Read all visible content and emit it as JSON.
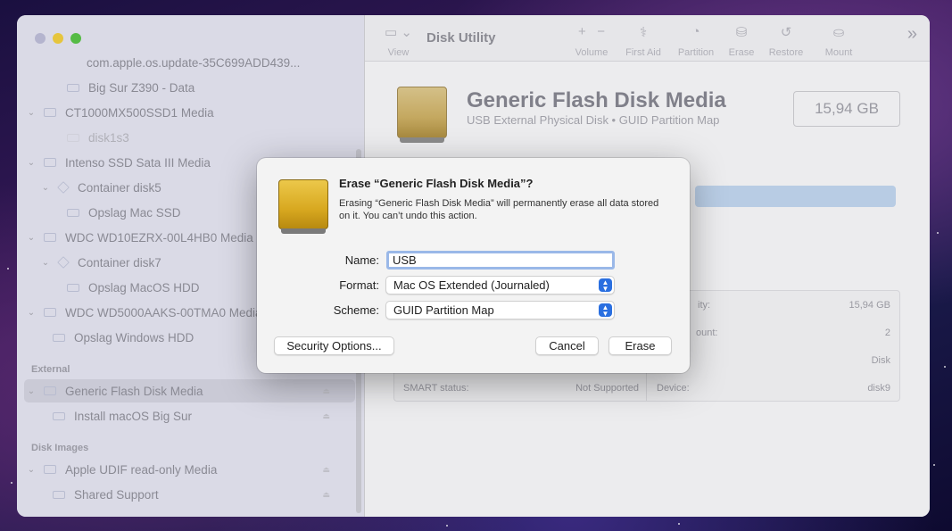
{
  "window": {
    "app_title": "Disk Utility"
  },
  "sidebar": {
    "rows": [
      {
        "label": "com.apple.os.update-35C699ADD439..."
      },
      {
        "label": "Big Sur Z390 - Data"
      },
      {
        "label": "CT1000MX500SSD1 Media"
      },
      {
        "label": "disk1s3"
      },
      {
        "label": "Intenso SSD Sata III Media"
      },
      {
        "label": "Container disk5"
      },
      {
        "label": "Opslag Mac SSD"
      },
      {
        "label": "WDC WD10EZRX-00L4HB0 Media"
      },
      {
        "label": "Container disk7"
      },
      {
        "label": "Opslag MacOS HDD"
      },
      {
        "label": "WDC WD5000AAKS-00TMA0 Media"
      },
      {
        "label": "Opslag Windows HDD"
      },
      {
        "label": "Generic Flash Disk Media"
      },
      {
        "label": "Install macOS Big Sur"
      },
      {
        "label": "Apple UDIF read-only Media"
      },
      {
        "label": "Shared Support"
      }
    ],
    "sections": {
      "external": "External",
      "disk_images": "Disk Images"
    }
  },
  "toolbar": {
    "view": "View",
    "volume": "Volume",
    "first_aid": "First Aid",
    "partition": "Partition",
    "erase": "Erase",
    "restore": "Restore",
    "mount": "Mount",
    "volume_add": "+",
    "volume_remove": "−"
  },
  "disk": {
    "name": "Generic Flash Disk Media",
    "subtitle": "USB External Physical Disk • GUID Partition Map",
    "size": "15,94 GB"
  },
  "info": {
    "capacity_label": "ity:",
    "capacity_value": "15,94 GB",
    "child_count_label": "ount:",
    "child_count_value": "2",
    "type_value": "Disk",
    "smart_label": "SMART status:",
    "smart_value": "Not Supported",
    "device_label": "Device:",
    "device_value": "disk9"
  },
  "dialog": {
    "title": "Erase “Generic Flash Disk Media”?",
    "message": "Erasing “Generic Flash Disk Media” will permanently erase all data stored on it. You can’t undo this action.",
    "name_label": "Name:",
    "name_value": "USB",
    "format_label": "Format:",
    "format_value": "Mac OS Extended (Journaled)",
    "scheme_label": "Scheme:",
    "scheme_value": "GUID Partition Map",
    "security_button": "Security Options...",
    "cancel_button": "Cancel",
    "erase_button": "Erase"
  }
}
